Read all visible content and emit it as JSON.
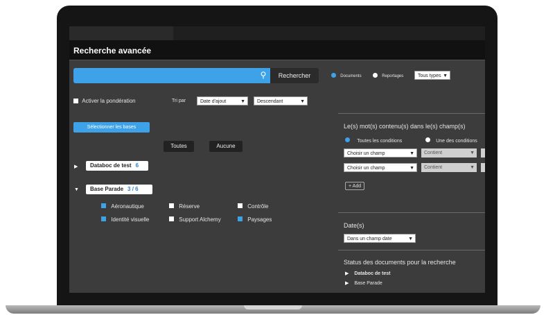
{
  "page": {
    "title": "Recherche avancée",
    "search_button": "Rechercher",
    "search_placeholder": "",
    "view_options": {
      "documents": "Documents",
      "reportages": "Reportages",
      "select_value": "Tous types"
    },
    "accent_color": "#3ea2e8"
  },
  "filters": {
    "activate_label": "Activer la pondération",
    "sort_label": "Tri par",
    "sort_value": "Date d'ajout",
    "order_value": "Descendant"
  },
  "databases": {
    "select_button": "Sélectionner les bases",
    "all_button": "Toutes",
    "none_button": "Aucune",
    "groups": [
      {
        "name": "Databoc de test",
        "count": "6"
      },
      {
        "name": "Base Parade",
        "count": "3 / 6"
      }
    ],
    "subitems": [
      {
        "label": "Aéronautique",
        "checked": true
      },
      {
        "label": "Réserve",
        "checked": false
      },
      {
        "label": "Contrôle",
        "checked": false
      },
      {
        "label": "Identité visuelle",
        "checked": true
      },
      {
        "label": "Support Alchemy",
        "checked": false
      },
      {
        "label": "Paysages",
        "checked": true
      }
    ]
  },
  "criteria": {
    "heading": "Le(s) mot(s) contenu(s) dans le(s) champ(s)",
    "radio_all": "Toutes les conditions",
    "radio_one": "Une des conditions",
    "field_select": "Choisir un champ",
    "op_select": "Contient",
    "add_button": "+ Add",
    "date_heading": "Date(s)",
    "date_select": "Dans un champ date",
    "status_heading": "Status des documents pour la recherche",
    "status_items": [
      "Databoc de test",
      "Base Parade"
    ]
  }
}
